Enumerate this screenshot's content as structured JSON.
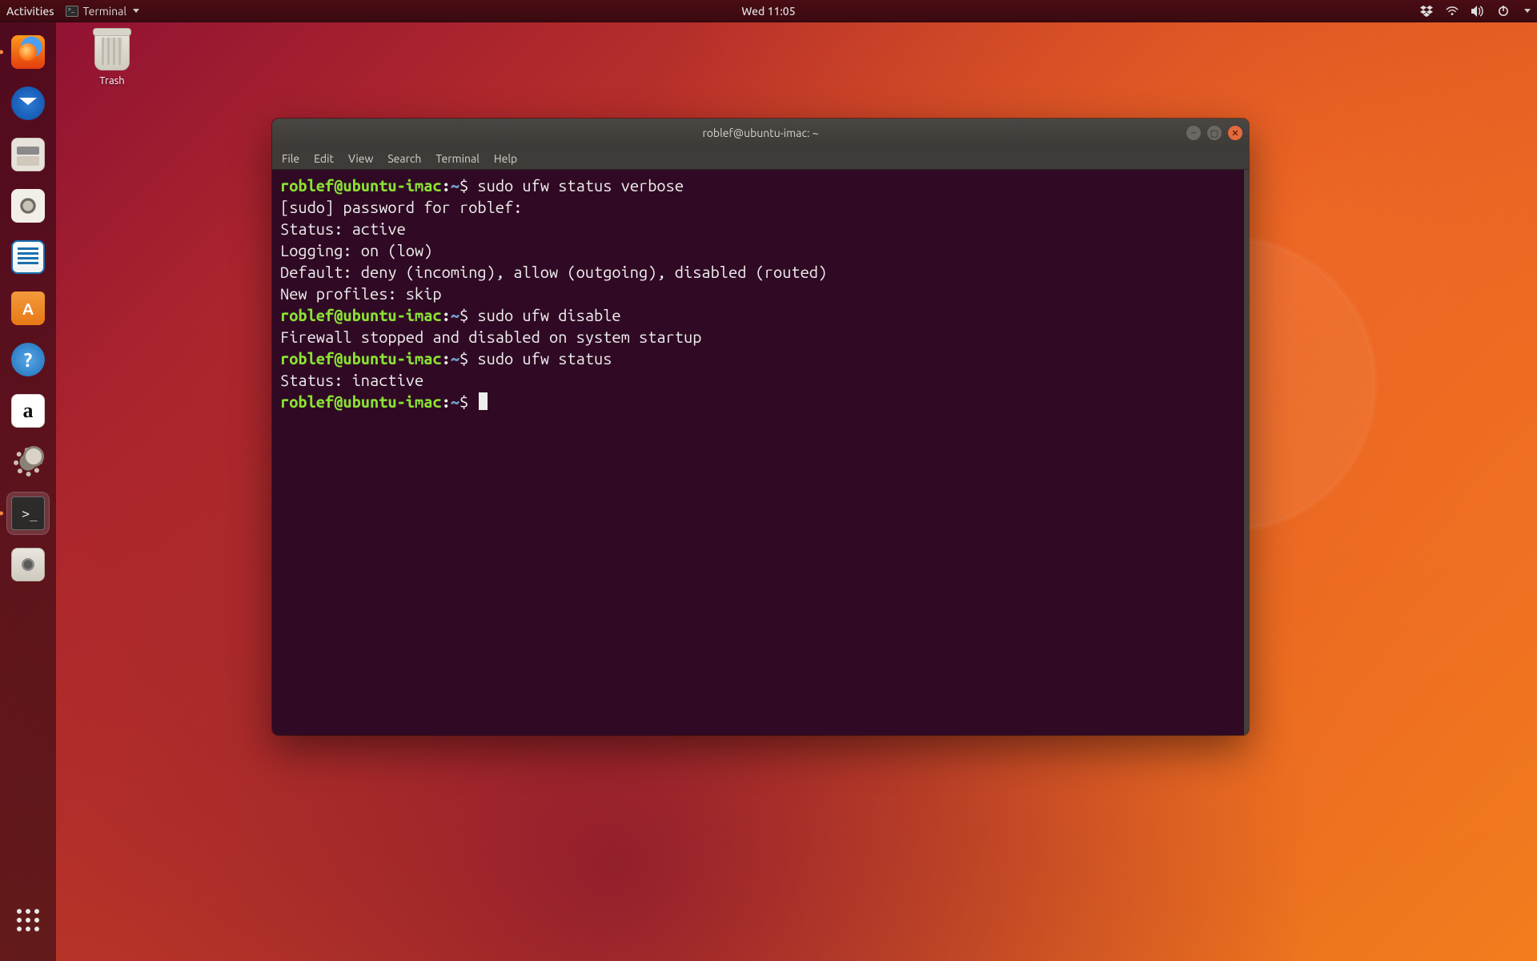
{
  "topbar": {
    "activities": "Activities",
    "app_label": "Terminal",
    "clock": "Wed 11:05"
  },
  "desktop": {
    "trash_label": "Trash"
  },
  "dock": {
    "items": [
      {
        "name": "firefox",
        "running": true
      },
      {
        "name": "thunderbird"
      },
      {
        "name": "files"
      },
      {
        "name": "rhythmbox"
      },
      {
        "name": "libreoffice-writer"
      },
      {
        "name": "ubuntu-software"
      },
      {
        "name": "help"
      },
      {
        "name": "amazon"
      },
      {
        "name": "settings"
      },
      {
        "name": "terminal",
        "active": true,
        "running": true
      },
      {
        "name": "screenshot"
      }
    ]
  },
  "window": {
    "title": "roblef@ubuntu-imac: ~",
    "menus": [
      "File",
      "Edit",
      "View",
      "Search",
      "Terminal",
      "Help"
    ]
  },
  "terminal": {
    "prompt_user": "roblef@ubuntu-imac",
    "prompt_path": "~",
    "lines": [
      {
        "type": "prompt",
        "cmd": "sudo ufw status verbose"
      },
      {
        "type": "out",
        "text": "[sudo] password for roblef: "
      },
      {
        "type": "out",
        "text": "Status: active"
      },
      {
        "type": "out",
        "text": "Logging: on (low)"
      },
      {
        "type": "out",
        "text": "Default: deny (incoming), allow (outgoing), disabled (routed)"
      },
      {
        "type": "out",
        "text": "New profiles: skip"
      },
      {
        "type": "prompt",
        "cmd": "sudo ufw disable"
      },
      {
        "type": "out",
        "text": "Firewall stopped and disabled on system startup"
      },
      {
        "type": "prompt",
        "cmd": "sudo ufw status"
      },
      {
        "type": "out",
        "text": "Status: inactive"
      },
      {
        "type": "prompt",
        "cmd": "",
        "cursor": true
      }
    ]
  }
}
